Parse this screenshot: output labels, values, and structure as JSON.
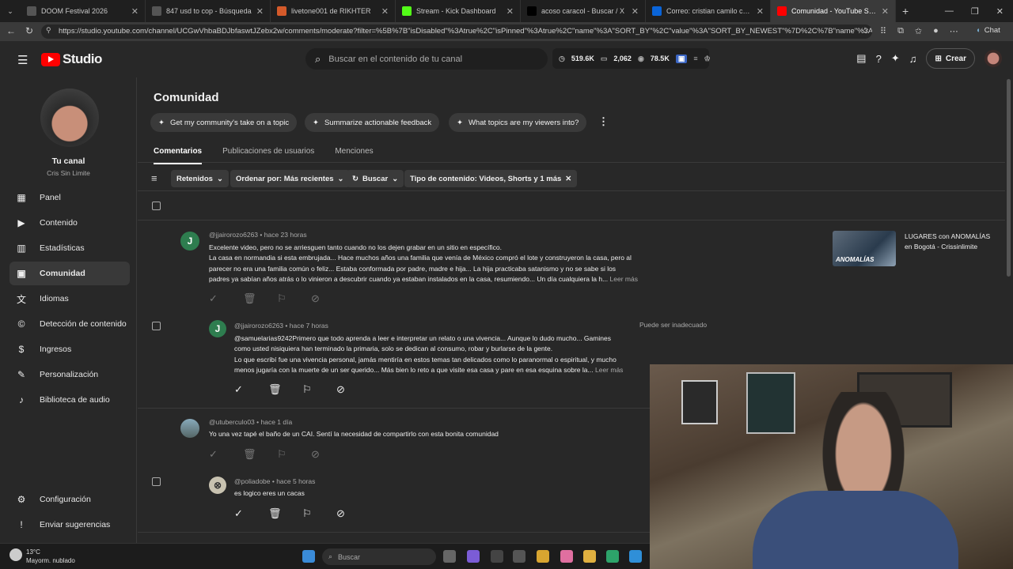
{
  "tabs": [
    {
      "title": "DOOM Festival 2026",
      "color": "#555"
    },
    {
      "title": "847 usd to cop - Búsqueda",
      "color": "#555"
    },
    {
      "title": "livetone001 de RIKHTER",
      "color": "#d45a2a"
    },
    {
      "title": "Stream - Kick Dashboard",
      "color": "#53fc18"
    },
    {
      "title": "acoso caracol - Buscar / X",
      "color": "#000"
    },
    {
      "title": "Correo: cristian camilo castro sote",
      "color": "#0a64d8"
    },
    {
      "title": "Comunidad - YouTube Studio",
      "color": "#ff0000"
    }
  ],
  "url": "https://studio.youtube.com/channel/UCGwVhbaBDJbfaswtJZebx2w/comments/moderate?filter=%5B%7B\"isDisabled\"%3Atrue%2C\"isPinned\"%3Atrue%2C\"name\"%3A\"SORT_BY\"%2C\"value\"%3A\"SORT_BY_NEWEST\"%7D%2C%7B\"name\"%3A\"PARE...",
  "browser": {
    "chat_label": "Chat"
  },
  "header": {
    "logo_text": "Studio",
    "search_placeholder": "Buscar en el contenido de tu canal",
    "stat_views": "519.6K",
    "stat_comments": "2,062",
    "stat_subs": "78.5K",
    "create_label": "Crear"
  },
  "channel": {
    "label": "Tu canal",
    "name": "Cris Sin Limite"
  },
  "sidebar": [
    {
      "label": "Panel",
      "icon": "dashboard-icon"
    },
    {
      "label": "Contenido",
      "icon": "content-icon"
    },
    {
      "label": "Estadísticas",
      "icon": "analytics-icon"
    },
    {
      "label": "Comunidad",
      "icon": "community-icon"
    },
    {
      "label": "Idiomas",
      "icon": "languages-icon"
    },
    {
      "label": "Detección de contenido",
      "icon": "copyright-icon"
    },
    {
      "label": "Ingresos",
      "icon": "earn-icon"
    },
    {
      "label": "Personalización",
      "icon": "customization-icon"
    },
    {
      "label": "Biblioteca de audio",
      "icon": "audio-library-icon"
    }
  ],
  "sidebar_bottom": [
    {
      "label": "Configuración",
      "icon": "settings-icon"
    },
    {
      "label": "Enviar sugerencias",
      "icon": "feedback-icon"
    }
  ],
  "page": {
    "title": "Comunidad",
    "chips": [
      "Get my community's take on a topic",
      "Summarize actionable feedback",
      "What topics are my viewers into?"
    ],
    "tabs": [
      "Comentarios",
      "Publicaciones de usuarios",
      "Menciones"
    ],
    "filters": [
      "Retenidos",
      "Ordenar por: Más recientes",
      "Buscar",
      "Tipo de contenido: Videos, Shorts y 1 más"
    ]
  },
  "comments": [
    {
      "author": "@jjairorozo6263",
      "time": "hace 23 horas",
      "avatar_letter": "J",
      "avatar_color": "#2e7d4f",
      "lines": [
        "Excelente video, pero no se arriesguen tanto cuando no los dejen grabar en un sitio en específico.",
        "La casa en normandia si esta embrujada... Hace muchos años una familia que venía de México compró el lote y construyeron la casa, pero al",
        "parecer no era una familia común o feliz... Estaba conformada por padre, madre e hija... La hija practicaba satanismo y no se sabe si los",
        "padres ya sabían años atrás o lo vinieron a descubrir cuando ya estaban instalados en la casa, resumiendo... Un día cualquiera la h..."
      ],
      "more": "Leer más"
    },
    {
      "author": "@jjairorozo6263",
      "time": "hace 7 horas",
      "avatar_letter": "J",
      "avatar_color": "#2e7d4f",
      "note": "Puede ser inadecuado",
      "lines": [
        "@samuelarias9242Primero que todo aprenda a leer e interpretar un relato o una vivencia... Aunque lo dudo mucho... Gamines",
        "como usted nisiquiera han terminado la primaria, solo se dedican al consumo, robar y burlarse de la gente.",
        "Lo que escribí fue una vivencia personal, jamás mentiría en estos temas tan delicados como lo paranormal o espiritual, y mucho",
        "menos jugaría con la muerte de un ser querido... Más bien lo reto a que visite esa casa y pare en esa esquina sobre la..."
      ],
      "more": "Leer más"
    },
    {
      "author": "@utuberculo03",
      "time": "hace 1 día",
      "lines": [
        "Yo una vez tapé el baño de un CAI. Sentí la necesidad de compartirlo con esta bonita comunidad"
      ]
    },
    {
      "author": "@poliadobe",
      "time": "hace 5 horas",
      "lines": [
        "es logico eres un cacas"
      ]
    }
  ],
  "video": {
    "title": "LUGARES con ANOMALÍAS en Bogotá - Crissinlimite",
    "thumb_text": "ANOMALÍAS"
  },
  "taskbar": {
    "temp": "13°C",
    "weather": "Mayorm. nublado",
    "search": "Buscar"
  }
}
